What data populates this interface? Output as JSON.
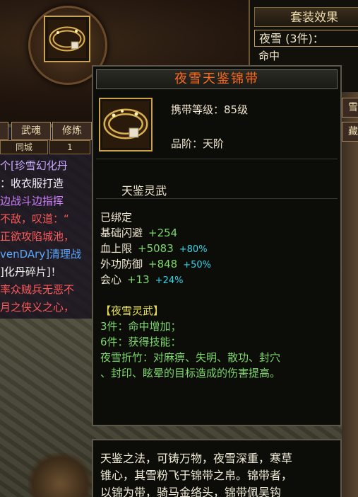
{
  "chat": {
    "tab_left": "",
    "tab1": "武魂",
    "tab2": "修炼",
    "sub1": "同城",
    "sub2": "1",
    "lines": [
      {
        "text": "个[珍雪幻化丹",
        "color": "#c8a8ff"
      },
      {
        "text": "：收衣服打造",
        "color": "#f4eefc"
      },
      {
        "text": "边战斗边指挥",
        "color": "#d080ff"
      },
      {
        "text": "不敌，叹道：“",
        "color": "#ff5a5a"
      },
      {
        "text": "正欲攻陷城池，",
        "color": "#ff5a5a"
      },
      {
        "text": "venDAry]清理战",
        "color": "#5aa8ff"
      },
      {
        "text": "]化丹碎片]！",
        "color": "#f0f0f0"
      },
      {
        "text": "率众贼兵无恶不",
        "color": "#ff5a5a"
      },
      {
        "text": "月之侠义之心，",
        "color": "#ff5a5a"
      }
    ]
  },
  "suit": {
    "title": "套装效果",
    "row": "夜雪 (3件)：",
    "row2": "命中",
    "side_btns": [
      "雪",
      "藏"
    ]
  },
  "tooltip": {
    "title": "夜雪天鉴锦带",
    "carry_level": "携带等级：85级",
    "grade": "品阶：天阶",
    "name_line": "天鉴灵武",
    "bound": "已绑定",
    "stats": [
      {
        "label": "基础闪避",
        "value": "+254",
        "extra": ""
      },
      {
        "label": "血上限",
        "value": "+5083",
        "extra": "+80%"
      },
      {
        "label": "外功防御",
        "value": "+848",
        "extra": "+50%"
      },
      {
        "label": "会心",
        "value": "+13",
        "extra": "+24%"
      }
    ],
    "set_header": "【夜雪灵武】",
    "set_line1": "3件：命中增加；",
    "set_line2": "6件：获得技能：",
    "set_line3": "夜雪折竹：对麻痹、失明、散功、封穴",
    "set_line4": "、封印、眩晕的目标造成的伤害提高。"
  },
  "lore": {
    "line1": "天鉴之法，可铸万物，夜雪深重，寒草",
    "line2": "锥心，其雪粉飞于锦带之帛。锦带者，",
    "line3": "以锦为带，骑马金络头，锦带佩吴钩"
  },
  "colors": {
    "title_orange": "#ff6a1a",
    "stat_green": "#7dd86a",
    "stat_cyan": "#34d6e8",
    "set_yellow": "#e8e050"
  }
}
